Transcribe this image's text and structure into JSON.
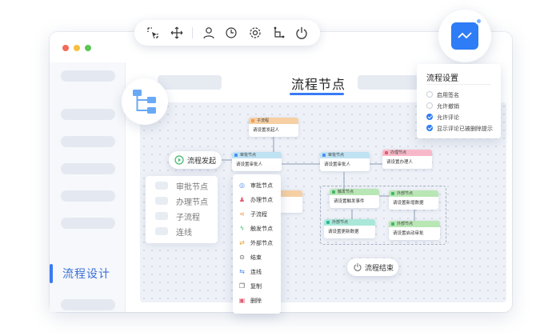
{
  "sidebar": {
    "active_label": "流程设计"
  },
  "header": {
    "tab_title": "流程节点"
  },
  "toolbar": {
    "icons": [
      "select-icon",
      "move-icon",
      "user-icon",
      "timer-icon",
      "gear-icon",
      "branch-icon",
      "power-icon"
    ]
  },
  "settings_panel": {
    "title": "流程设置",
    "options": [
      {
        "label": "启用签名",
        "checked": false
      },
      {
        "label": "允许撤销",
        "checked": false
      },
      {
        "label": "允许评论",
        "checked": true
      },
      {
        "label": "显示评论已被删除提示",
        "checked": true
      }
    ]
  },
  "flow": {
    "start_label": "流程发起",
    "end_label": "流程结束",
    "nodes": [
      {
        "id": "sub",
        "header": "子流程",
        "body": "请设置发起人",
        "color": "#f6cfa3"
      },
      {
        "id": "approve1",
        "header": "审批节点",
        "body": "请设置审批人",
        "color": "#bfe3f3"
      },
      {
        "id": "approve2",
        "header": "审批节点",
        "body": "请设置审批人",
        "color": "#bfe3f3"
      },
      {
        "id": "handle",
        "header": "办理节点",
        "body": "请设置办理人",
        "color": "#f7b9c9"
      },
      {
        "id": "trigger",
        "header": "触发节点",
        "body": "请设置触发事件",
        "color": "#b8e6b4"
      },
      {
        "id": "ext",
        "header": "外部节点",
        "body": "请设置新增数据",
        "color": "#b8e6b4"
      },
      {
        "id": "ext2",
        "header": "外部节点",
        "body": "请设置更新数据",
        "color": "#a9e8d9"
      },
      {
        "id": "ext3",
        "header": "外部节点",
        "body": "请设置启动审批",
        "color": "#b8e6b4"
      }
    ]
  },
  "node_types": [
    "审批节点",
    "办理节点",
    "子流程",
    "连线"
  ],
  "context_menu": [
    {
      "icon": "user-icon",
      "label": "审批节点",
      "color": "#4a8cf6"
    },
    {
      "icon": "stamp-icon",
      "label": "办理节点",
      "color": "#e35b6f"
    },
    {
      "icon": "share-icon",
      "label": "子流程",
      "color": "#f29a4a"
    },
    {
      "icon": "lightning-icon",
      "label": "触发节点",
      "color": "#3fb86a"
    },
    {
      "icon": "swap-icon",
      "label": "外部节点",
      "color": "#e0a93a"
    },
    {
      "icon": "stop-icon",
      "label": "结束",
      "color": "#555555"
    },
    {
      "icon": "link-icon",
      "label": "连线",
      "color": "#4a8cf6"
    },
    {
      "icon": "copy-icon",
      "label": "复制",
      "color": "#555555"
    },
    {
      "icon": "trash-icon",
      "label": "删除",
      "color": "#e35b6f"
    }
  ],
  "colors": {
    "accent": "#3a7bf5"
  }
}
